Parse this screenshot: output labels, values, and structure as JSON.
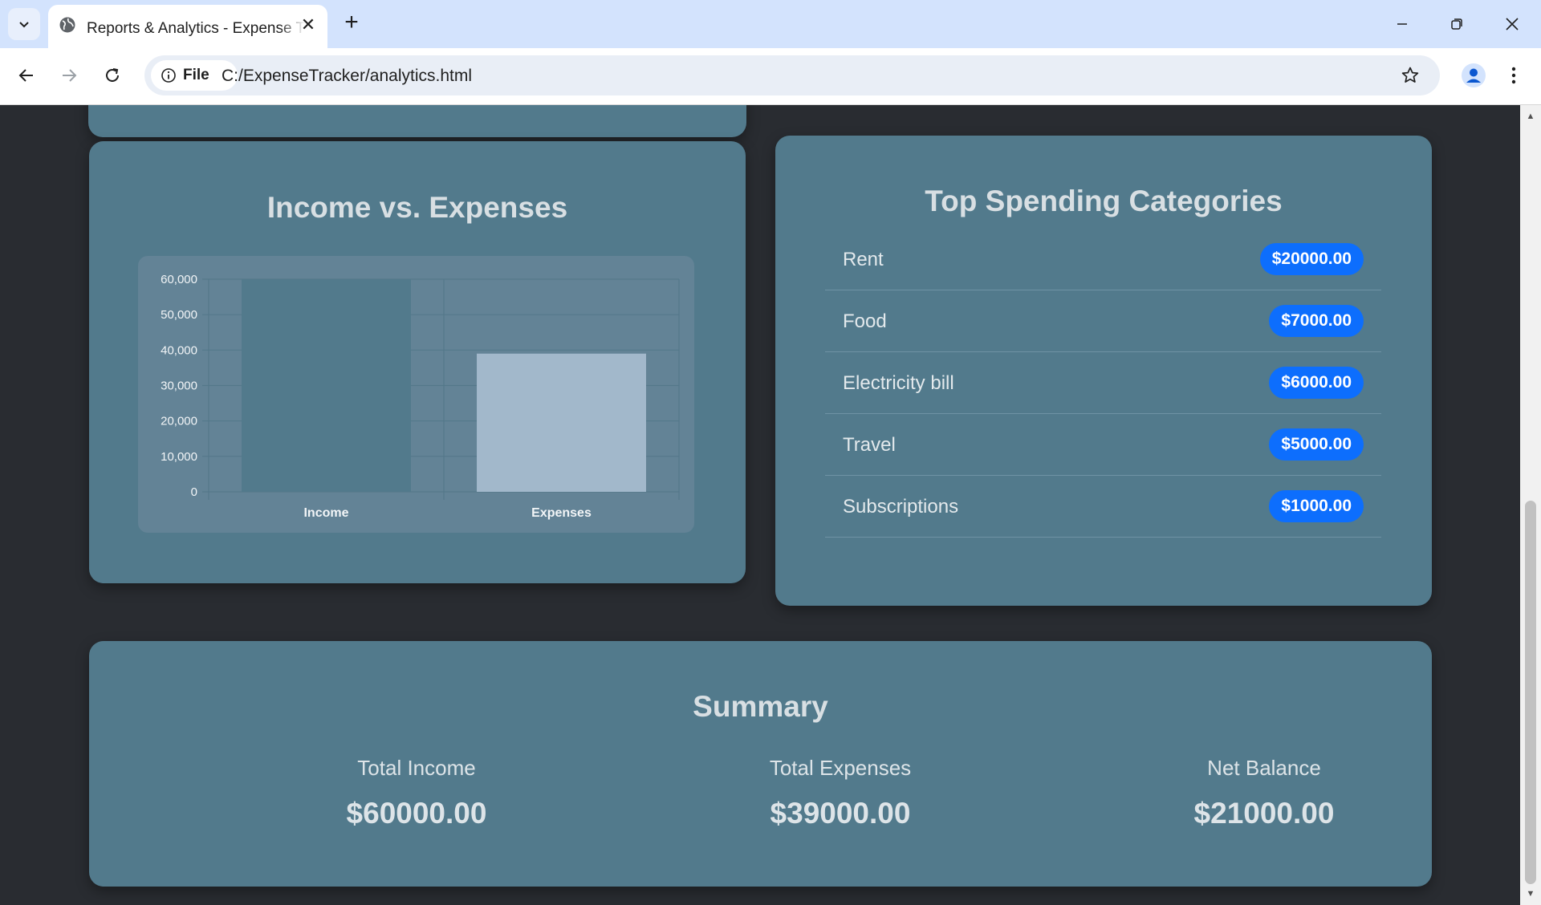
{
  "browser": {
    "tab_title": "Reports & Analytics - Expense Tracker",
    "site_chip_label": "File",
    "url": "C:/ExpenseTracker/analytics.html",
    "icons": [
      "tab-search-icon",
      "globe-icon",
      "close-icon",
      "plus-icon",
      "minimize-icon",
      "restore-icon",
      "close-window-icon",
      "back-arrow-icon",
      "forward-arrow-icon",
      "reload-icon",
      "info-icon",
      "star-icon",
      "profile-icon",
      "kebab-menu-icon"
    ]
  },
  "income_card": {
    "title": "Income vs. Expenses"
  },
  "chart_data": {
    "type": "bar",
    "categories": [
      "Income",
      "Expenses"
    ],
    "values": [
      60000,
      39000
    ],
    "colors": [
      "#527a8c",
      "#a2b8cb"
    ],
    "ylim": [
      0,
      60000
    ],
    "y_ticks": [
      0,
      10000,
      20000,
      30000,
      40000,
      50000,
      60000
    ],
    "y_tick_labels": [
      "0",
      "10,000",
      "20,000",
      "30,000",
      "40,000",
      "50,000",
      "60,000"
    ],
    "grid": true,
    "title": "",
    "xlabel": "",
    "ylabel": ""
  },
  "top_categories": {
    "title": "Top Spending Categories",
    "items": [
      {
        "name": "Rent",
        "amount": "$20000.00"
      },
      {
        "name": "Food",
        "amount": "$7000.00"
      },
      {
        "name": "Electricity bill",
        "amount": "$6000.00"
      },
      {
        "name": "Travel",
        "amount": "$5000.00"
      },
      {
        "name": "Subscriptions",
        "amount": "$1000.00"
      }
    ],
    "badge_color": "#0d6efd"
  },
  "summary": {
    "title": "Summary",
    "total_income_label": "Total Income",
    "total_income_value": "$60000.00",
    "total_expenses_label": "Total Expenses",
    "total_expenses_value": "$39000.00",
    "net_balance_label": "Net Balance",
    "net_balance_value": "$21000.00"
  },
  "colors": {
    "page_bg": "#292c31",
    "card_bg": "#527a8c",
    "chart_bg": "#638396",
    "tabstrip_bg": "#d3e3fd"
  }
}
